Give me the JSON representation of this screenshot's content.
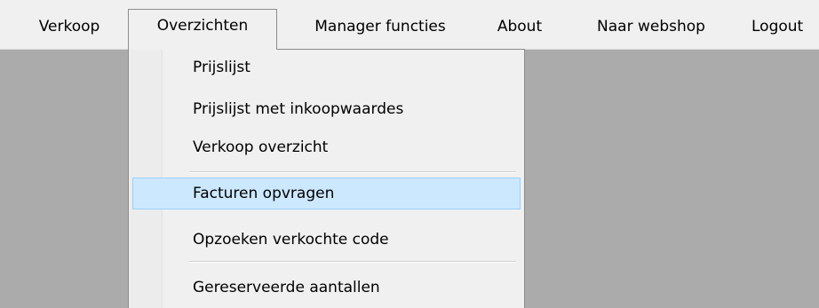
{
  "menubar": {
    "items": [
      {
        "label": "Verkoop"
      },
      {
        "label": "Overzichten"
      },
      {
        "label": "Manager functies"
      },
      {
        "label": "About"
      },
      {
        "label": "Naar webshop"
      },
      {
        "label": "Logout"
      }
    ],
    "active_item": "Overzichten"
  },
  "dropdown": {
    "items": [
      {
        "label": "Prijslijst"
      },
      {
        "label": "Prijslijst met inkoopwaardes"
      },
      {
        "label": "Verkoop overzicht"
      },
      {
        "label": "Facturen opvragen"
      },
      {
        "label": "Opzoeken verkochte code"
      },
      {
        "label": "Gereserveerde aantallen"
      }
    ],
    "selected_item": "Facturen opvragen"
  },
  "colors": {
    "menubar_bg": "#f0f0f0",
    "workspace_bg": "#ababab",
    "highlight_bg": "#cce8ff",
    "highlight_border": "#99d1ff"
  }
}
